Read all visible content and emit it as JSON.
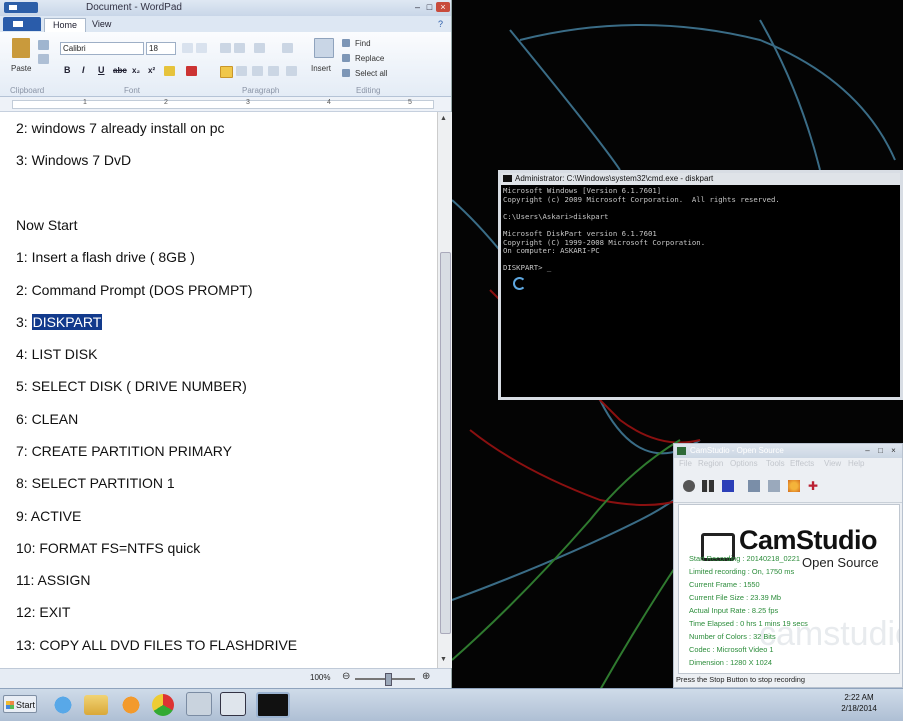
{
  "wordpad": {
    "title": "Document - WordPad",
    "tabs": [
      "Home",
      "View"
    ],
    "ribbon": {
      "paste": "Paste",
      "font_name": "Calibri",
      "font_size": "18",
      "insert": "Insert",
      "find": "Find",
      "replace": "Replace",
      "select_all": "Select all",
      "groups": [
        "Clipboard",
        "Font",
        "Paragraph",
        "Editing"
      ]
    },
    "ruler_numbers": [
      "1",
      "2",
      "3",
      "4",
      "5"
    ],
    "lines": [
      "2: windows 7 already install on pc",
      "3: Windows 7 DvD",
      "Now Start",
      "1: Insert a flash drive ( 8GB )",
      "2: Command Prompt (DOS PROMPT)",
      "3: ",
      "4: LIST DISK",
      "5: SELECT DISK ( DRIVE NUMBER)",
      "6: CLEAN",
      "7: CREATE PARTITION PRIMARY",
      "8: SELECT PARTITION 1",
      "9: ACTIVE",
      "10: FORMAT FS=NTFS quick",
      "11: ASSIGN",
      "12: EXIT",
      "13: COPY ALL DVD FILES TO FLASHDRIVE"
    ],
    "highlighted": "DISKPART",
    "zoom": "100%"
  },
  "cmd": {
    "title": "Administrator: C:\\Windows\\system32\\cmd.exe - diskpart",
    "output": "Microsoft Windows [Version 6.1.7601]\nCopyright (c) 2009 Microsoft Corporation.  All rights reserved.\n\nC:\\Users\\Askari>diskpart\n\nMicrosoft DiskPart version 6.1.7601\nCopyright (C) 1999-2008 Microsoft Corporation.\nOn computer: ASKARI-PC\n\nDISKPART> _"
  },
  "camstudio": {
    "title": "CamStudio - Open Source",
    "menu": [
      "File",
      "Region",
      "Options",
      "Tools",
      "Effects",
      "View",
      "Help"
    ],
    "logo": "CamStudio",
    "logo_sub": "Open Source",
    "watermark": "camstudio.org",
    "stats": [
      "Start Recording : 20140218_0221",
      "Limited recording : On, 1750 ms",
      "Current Frame : 1550",
      "Current File Size : 23.39 Mb",
      "Actual Input Rate : 8.25 fps",
      "Time Elapsed : 0 hrs 1 mins 19 secs",
      "Number of Colors : 32 Bits",
      "Codec : Microsoft Video 1",
      "Dimension : 1280 X 1024"
    ],
    "footer": "Press the Stop Button to stop recording"
  },
  "taskbar": {
    "start": "Start",
    "time": "2:22 AM",
    "date": "2/18/2014"
  }
}
